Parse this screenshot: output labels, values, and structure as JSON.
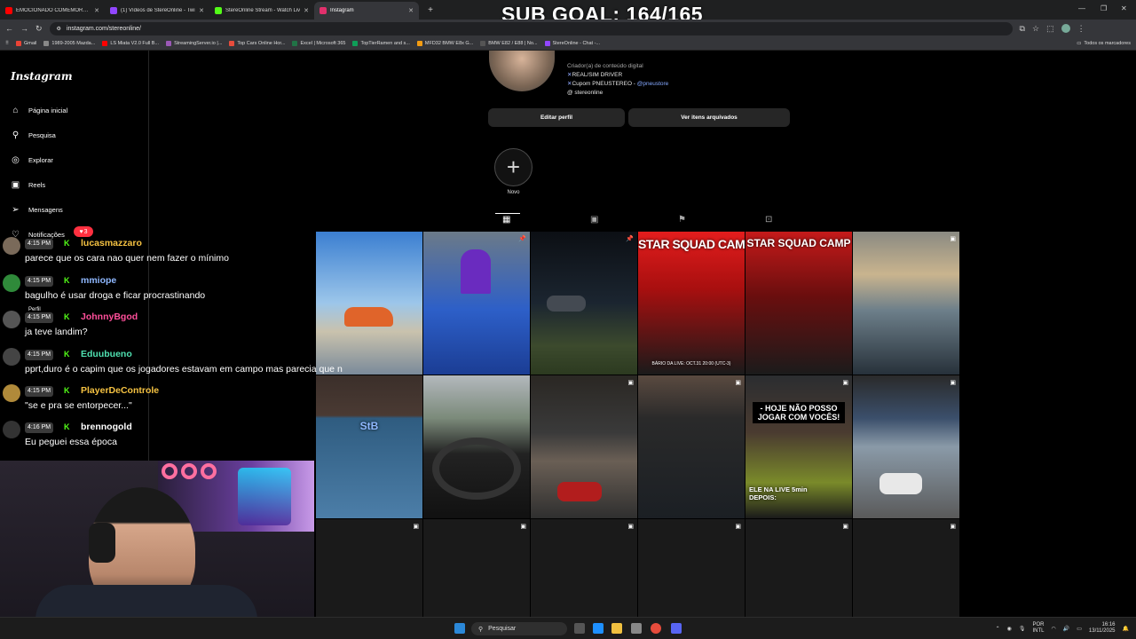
{
  "browser": {
    "tabs": [
      {
        "label": "EMOCIONADO COMEMORO!J",
        "color": "#ff0000",
        "active": false
      },
      {
        "label": "(1) Vídeos de StereOnline - Twi",
        "color": "#9146ff",
        "active": false
      },
      {
        "label": "StereOnline Stream - Watch Liv",
        "color": "#53fc18",
        "active": false
      },
      {
        "label": "Instagram",
        "color": "#e1306c",
        "active": true
      }
    ],
    "new_tab": "+",
    "url": "instagram.com/stereonline/",
    "bookmarks": [
      "Gmail",
      "1989-2005 Mazda...",
      "LS Miata V2.0 Full B...",
      "StreamingServer.io |...",
      "Top Cars Online Hor...",
      "Excel | Microsoft 365",
      "TopTierRamen and s...",
      "MFD32 BMW E8x G...",
      "BMW E82 / E88 | No...",
      "StereOnline - Chat -..."
    ],
    "all_bookmarks": "Todos os marcadores"
  },
  "overlay": {
    "sub_goal": "SUB GOAL: 164/165"
  },
  "sidebar": {
    "logo": "Instagram",
    "items": [
      {
        "label": "Página inicial",
        "icon": "home-icon"
      },
      {
        "label": "Pesquisa",
        "icon": "search-icon"
      },
      {
        "label": "Explorar",
        "icon": "compass-icon"
      },
      {
        "label": "Reels",
        "icon": "reels-icon"
      },
      {
        "label": "Mensagens",
        "icon": "messenger-icon"
      },
      {
        "label": "Notificações",
        "icon": "heart-icon"
      },
      {
        "label": "Perfil",
        "icon": "profile-icon"
      }
    ],
    "notification_count": "3"
  },
  "profile": {
    "category": "Criador(a) de conteúdo digital",
    "bio_line1": "REAL/SIM DRIVER",
    "bio_line2_prefix": "Cupom PNEUSTEREO - ",
    "bio_line2_link": "@pneustore",
    "threads": "stereonline",
    "edit_button": "Editar perfil",
    "archive_button": "Ver itens arquivados",
    "new_highlight": "Novo"
  },
  "chat": [
    {
      "time": "4:15 PM",
      "user": "lucasmazzaro",
      "color": "#f5c242",
      "msg": "parece que os cara nao quer nem fazer o mínimo"
    },
    {
      "time": "4:15 PM",
      "user": "mmiope",
      "color": "#8fb8ff",
      "msg": "bagulho é usar droga e ficar procrastinando"
    },
    {
      "time": "4:15 PM",
      "user": "JohnnyBgod",
      "color": "#ff4f9a",
      "msg": "ja teve landim?"
    },
    {
      "time": "4:15 PM",
      "user": "Eduubueno",
      "color": "#4fe0b0",
      "msg": "pprt,duro é o capim que os jogadores estavam em campo mas parecia que n"
    },
    {
      "time": "4:15 PM",
      "user": "PlayerDeControle",
      "color": "#f5c242",
      "msg": "\"se e pra se entorpecer...\""
    },
    {
      "time": "4:16 PM",
      "user": "brennogold",
      "color": "#ffffff",
      "msg": "Eu peguei essa época"
    }
  ],
  "grid": {
    "captions": {
      "star_squad": "STAR SQUAD CAMP",
      "live_schedule": "BÁRIO DA LIVE: OCT.31 20:00 (UTC-3)",
      "hoje": "- HOJE NÃO POSSO JOGAR COM VOCÊS!",
      "live": "ELE NA LIVE 5min DEPOIS:",
      "stb": "StB"
    }
  },
  "taskbar": {
    "search": "Pesquisar",
    "lang1": "POR",
    "lang2": "INTL",
    "time": "16:16",
    "date": "13/11/2025"
  }
}
